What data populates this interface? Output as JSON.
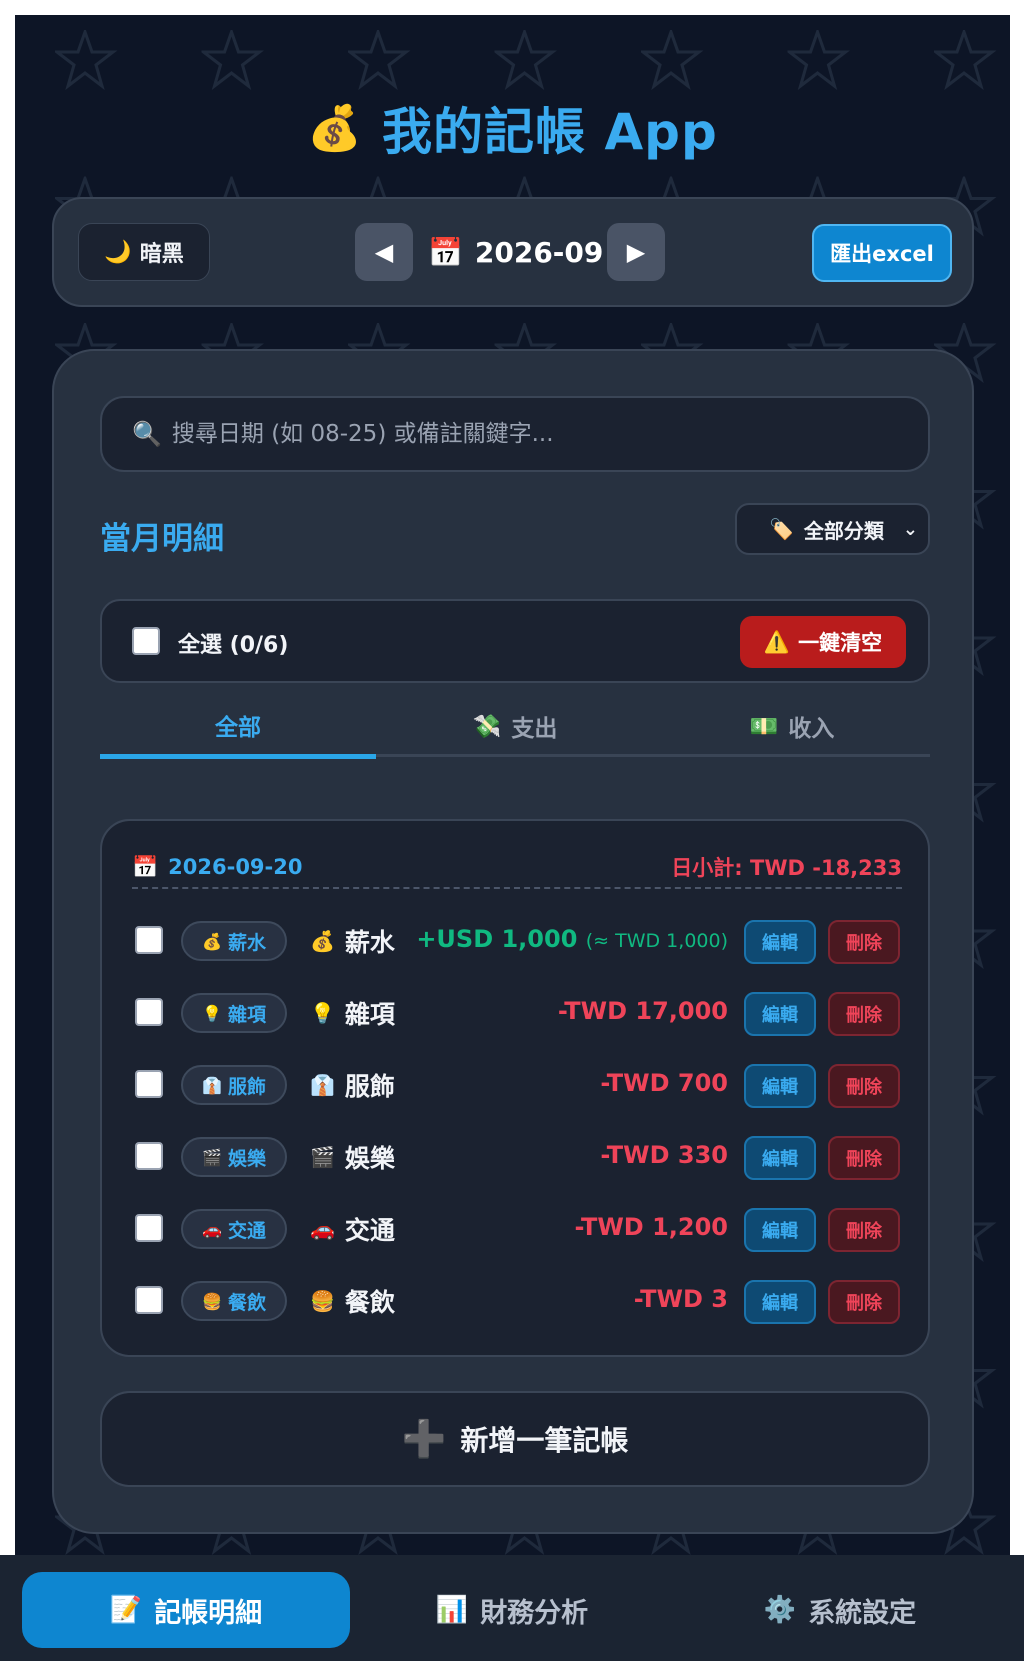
{
  "app": {
    "icon": "money-bag-icon",
    "title": "我的記帳 App"
  },
  "toolbar": {
    "theme": {
      "icon": "moon-icon",
      "label": "暗黑"
    },
    "month": "2026-09",
    "export_label": "匯出excel"
  },
  "search": {
    "placeholder": "搜尋日期 (如 08-25) 或備註關鍵字..."
  },
  "section_title": "當月明細",
  "category_filter": {
    "icon": "tag-icon",
    "value": "全部分類"
  },
  "select_all": {
    "label": "全選 (0/6)",
    "clear_label": "一鍵清空"
  },
  "tabs": [
    {
      "label": "全部",
      "icon": "",
      "active": true
    },
    {
      "label": "支出",
      "icon": "money-wings-icon",
      "active": false
    },
    {
      "label": "收入",
      "icon": "banknote-icon",
      "active": false
    }
  ],
  "day": {
    "date": "2026-09-20",
    "subtotal": "日小計: TWD -18,233"
  },
  "entries": [
    {
      "tag": "薪水",
      "icon": "money-bag-icon",
      "name": "薪水",
      "amount": "+USD 1,000",
      "converted": "(≈ TWD 1,000)",
      "type": "income"
    },
    {
      "tag": "雜項",
      "icon": "light-bulb-icon",
      "name": "雜項",
      "amount": "-TWD 17,000",
      "converted": "",
      "type": "expense"
    },
    {
      "tag": "服飾",
      "icon": "suit-icon",
      "name": "服飾",
      "amount": "-TWD 700",
      "converted": "",
      "type": "expense"
    },
    {
      "tag": "娛樂",
      "icon": "clapper-icon",
      "name": "娛樂",
      "amount": "-TWD 330",
      "converted": "",
      "type": "expense"
    },
    {
      "tag": "交通",
      "icon": "car-icon",
      "name": "交通",
      "amount": "-TWD 1,200",
      "converted": "",
      "type": "expense"
    },
    {
      "tag": "餐飲",
      "icon": "burger-icon",
      "name": "餐飲",
      "amount": "-TWD 3",
      "converted": "",
      "type": "expense"
    }
  ],
  "entry_actions": {
    "edit": "編輯",
    "delete": "刪除"
  },
  "add_label": "新增一筆記帳",
  "bottom_nav": [
    {
      "label": "記帳明細",
      "icon": "memo-icon",
      "active": true
    },
    {
      "label": "財務分析",
      "icon": "bar-chart-icon",
      "active": false
    },
    {
      "label": "系統設定",
      "icon": "gear-icon",
      "active": false
    }
  ],
  "colors": {
    "accent": "#3aabf0",
    "income": "#10b981",
    "expense": "#ef4459",
    "background": "#0d1526",
    "panel": "#273140"
  }
}
